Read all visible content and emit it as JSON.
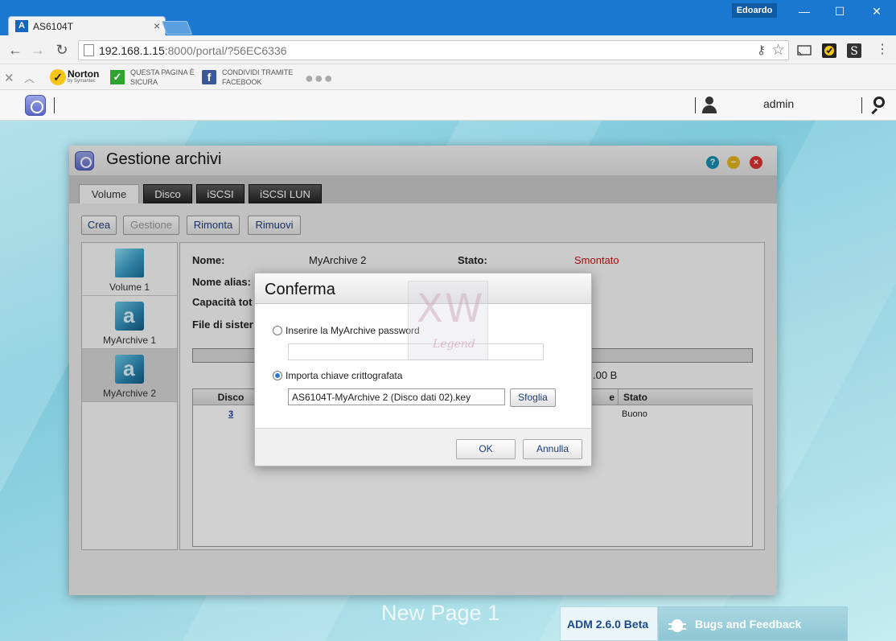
{
  "browser": {
    "tab_title": "AS6104T",
    "profile_name": "Edoardo",
    "url_main": "192.168.1.15",
    "url_rest": ":8000/portal/?56EC6336"
  },
  "bookmarks": {
    "norton_brand": "Norton",
    "norton_sub": "by Symantec",
    "safe_line1": "QUESTA PAGINA È",
    "safe_line2": "SICURA",
    "share_line1": "CONDIVIDI TRAMITE",
    "share_line2": "FACEBOOK"
  },
  "portal": {
    "user": "admin"
  },
  "app": {
    "title": "Gestione archivi",
    "tabs": [
      "Volume",
      "Disco",
      "iSCSI",
      "iSCSI LUN"
    ],
    "actions": [
      "Crea",
      "Gestione",
      "Rimonta",
      "Rimuovi"
    ],
    "volumes": [
      "Volume 1",
      "MyArchive 1",
      "MyArchive 2"
    ],
    "details": {
      "name_label": "Nome:",
      "name_value": "MyArchive 2",
      "status_label": "Stato:",
      "status_value": "Smontato",
      "alias_label": "Nome alias:",
      "capacity_label": "Capacità tot",
      "fs_label": "File di sister",
      "size_suffix": ".00 B"
    },
    "disk_table": {
      "col_disk": "Disco",
      "col_partial": "e",
      "col_status": "Stato",
      "row_disk": "3",
      "row_status": "Buono"
    }
  },
  "modal": {
    "title": "Conferma",
    "option_password": "Inserire la MyArchive password",
    "option_key": "Importa chiave crittografata",
    "key_file": "AS6104T-MyArchive 2 (Disco dati 02).key",
    "browse_label": "Sfoglia",
    "ok_label": "OK",
    "cancel_label": "Annulla"
  },
  "watermark": {
    "letters": "XW",
    "legend": "Legend"
  },
  "footer": {
    "page_name": "New Page 1",
    "adm_version": "ADM 2.6.0 Beta",
    "feedback": "Bugs and Feedback"
  },
  "colors": {
    "chrome_blue": "#1b78d0",
    "status_red": "#cc1010",
    "radio_accent": "#2d7bd1"
  }
}
